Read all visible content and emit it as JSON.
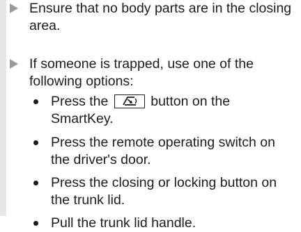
{
  "instructions": [
    {
      "text": "Ensure that no body parts are in the closing area."
    },
    {
      "text": "If someone is trapped, use one of the following options:",
      "sub_items": [
        {
          "before": "Press the",
          "icon": "trunk-open-key-icon",
          "after": "button on the SmartKey."
        },
        {
          "text": "Press the remote operating switch on the driver's door."
        },
        {
          "text": "Press the closing or locking button on the trunk lid."
        },
        {
          "text": "Pull the trunk lid handle."
        }
      ]
    }
  ]
}
